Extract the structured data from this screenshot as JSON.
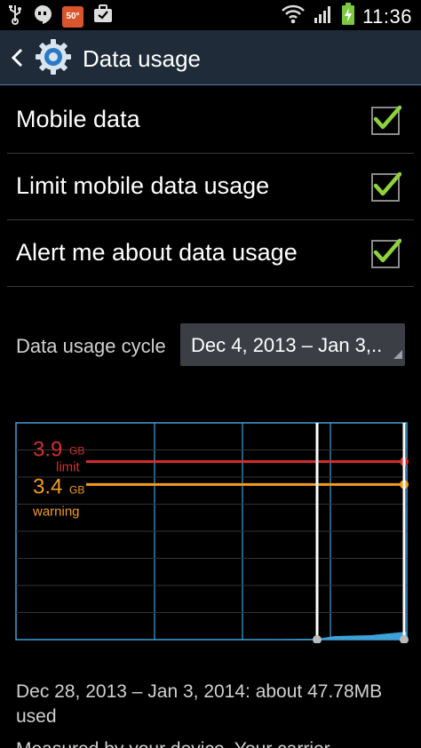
{
  "status_bar": {
    "left_icons": [
      "usb-icon",
      "hangouts-icon",
      "weather-icon",
      "briefcase-icon"
    ],
    "weather_temp": "50°",
    "right_icons": [
      "wifi-icon",
      "signal-icon",
      "battery-charging-icon"
    ],
    "time": "11:36"
  },
  "action_bar": {
    "title": "Data usage"
  },
  "settings": [
    {
      "label": "Mobile data",
      "checked": true
    },
    {
      "label": "Limit mobile data usage",
      "checked": true
    },
    {
      "label": "Alert me about data usage",
      "checked": true
    }
  ],
  "cycle": {
    "label": "Data usage cycle",
    "value": "Dec 4, 2013 – Jan 3,.."
  },
  "chart_data": {
    "type": "area",
    "limit": {
      "value": "3.9",
      "unit": "GB",
      "label": "limit",
      "gb": 3.9,
      "color": "#d32f2f"
    },
    "warning": {
      "value": "3.4",
      "unit": "GB",
      "label": "warning",
      "gb": 3.4,
      "color": "#f29b1d"
    },
    "y_range_gb": [
      0,
      4.75
    ],
    "grid": true,
    "grid_color": "#3ea0d8",
    "usage_color": "#3ea0d8",
    "selection_start_date": "Dec 28, 2013",
    "selection_end_date": "Jan 3, 2014",
    "selection_usage_mb": 47.78
  },
  "summary": {
    "text": "Dec 28, 2013 – Jan 3, 2014: about 47.78MB used"
  },
  "bottom_text": "Measured by your device. Your carrier"
}
